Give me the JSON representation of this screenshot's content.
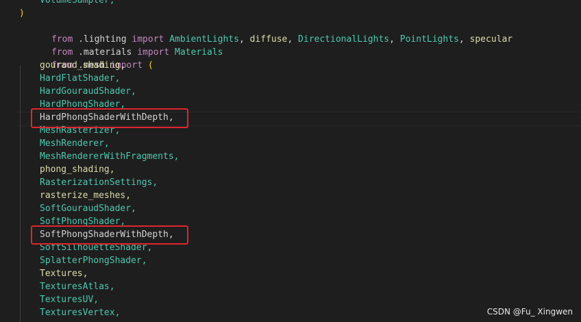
{
  "editor": {
    "top_partial": "VolumeSampler,",
    "close_paren": ")",
    "import_lighting": {
      "kw_from": "from",
      "module": ".lighting",
      "kw_import": "import",
      "names": [
        "AmbientLights",
        "diffuse",
        "DirectionalLights",
        "PointLights",
        "specular"
      ]
    },
    "import_materials": {
      "kw_from": "from",
      "module": ".materials",
      "kw_import": "import",
      "names": [
        "Materials"
      ]
    },
    "import_mesh": {
      "kw_from": "from",
      "module": ".mesh",
      "kw_import": "import",
      "open_paren": "("
    },
    "mesh_items": [
      "gouraud_shading,",
      "HardFlatShader,",
      "HardGouraudShader,",
      "HardPhongShader,",
      "HardPhongShaderWithDepth,",
      "MeshRasterizer,",
      "MeshRenderer,",
      "MeshRendererWithFragments,",
      "phong_shading,",
      "RasterizationSettings,",
      "rasterize_meshes,",
      "SoftGouraudShader,",
      "SoftPhongShader,",
      "SoftPhongShaderWithDepth,",
      "SoftSilhouetteShader,",
      "SplatterPhongShader,",
      "Textures,",
      "TexturesAtlas,",
      "TexturesUV,",
      "TexturesVertex,"
    ]
  },
  "colors": {
    "background": "#1e1e1e",
    "keyword": "#c586c0",
    "class": "#4ec9b0",
    "function": "#dcdcaa",
    "highlight_box": "#e0262b"
  },
  "watermark": "CSDN @Fu_ Xingwen"
}
